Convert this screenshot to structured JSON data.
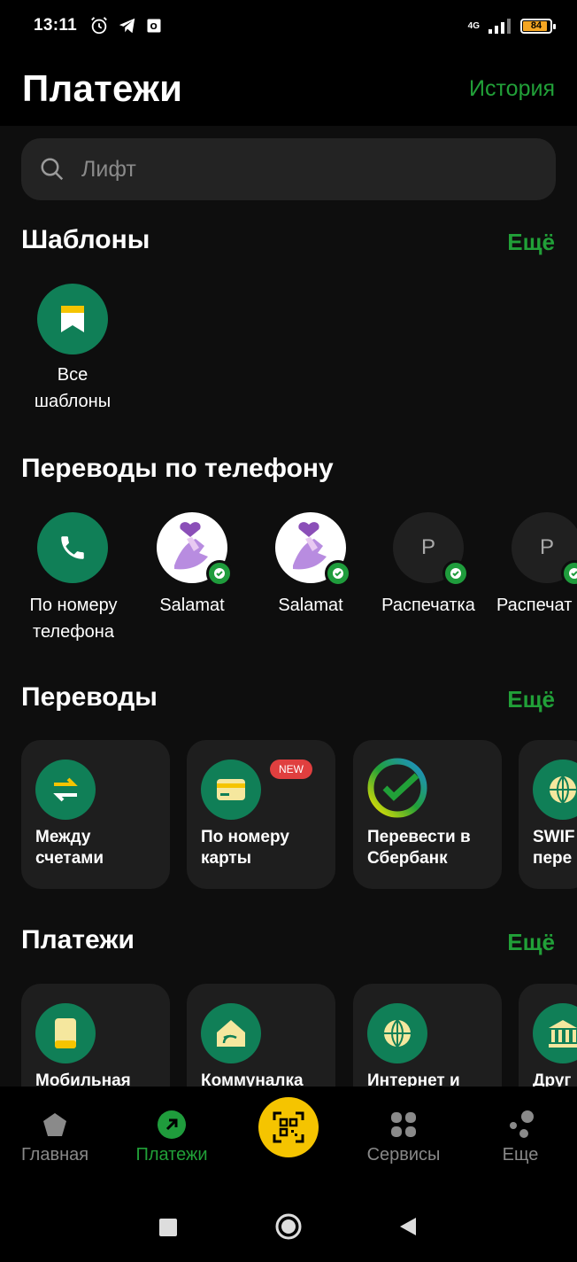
{
  "status": {
    "time": "13:11",
    "network": "4G",
    "battery": "84"
  },
  "header": {
    "title": "Платежи",
    "history": "История"
  },
  "search": {
    "placeholder": "Лифт"
  },
  "templates": {
    "title": "Шаблоны",
    "more": "Ещё",
    "items": [
      {
        "label_line1": "Все",
        "label_line2": "шаблоны"
      }
    ]
  },
  "phone_transfers": {
    "title": "Переводы по телефону",
    "items": [
      {
        "label_line1": "По номеру",
        "label_line2": "телефона"
      },
      {
        "label": "Salamat"
      },
      {
        "label": "Salamat"
      },
      {
        "label": "Распечатка",
        "initial": "Р"
      },
      {
        "label": "Распечат",
        "initial": "Р"
      }
    ]
  },
  "transfers": {
    "title": "Переводы",
    "more": "Ещё",
    "items": [
      {
        "label": "Между\nсчетами"
      },
      {
        "label": "По номеру\nкарты",
        "badge": "NEW"
      },
      {
        "label": "Перевести в\nСбербанк"
      },
      {
        "label": "SWIF\nпере"
      }
    ]
  },
  "payments": {
    "title": "Платежи",
    "more": "Ещё",
    "items": [
      {
        "label": "Мобильная"
      },
      {
        "label": "Коммуналка"
      },
      {
        "label": "Интернет и"
      },
      {
        "label": "Друг"
      }
    ]
  },
  "bottom_nav": {
    "items": [
      {
        "label": "Главная"
      },
      {
        "label": "Платежи"
      },
      {
        "label": "Сервисы"
      },
      {
        "label": "Еще"
      }
    ]
  },
  "colors": {
    "accent": "#21a038",
    "icon_bg": "#107f57",
    "qr": "#f5c400",
    "new_badge": "#e03f3f"
  }
}
